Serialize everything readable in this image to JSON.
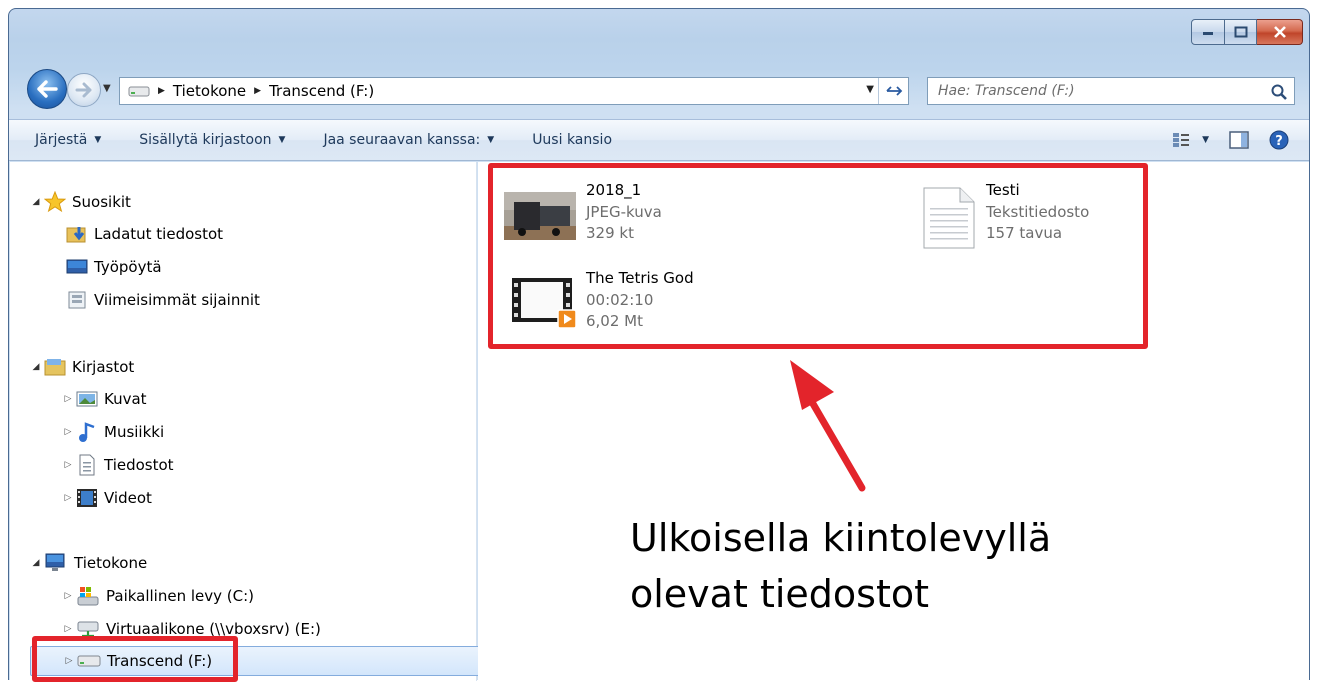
{
  "window": {
    "caption_buttons": [
      "minimize",
      "maximize",
      "close"
    ]
  },
  "address": {
    "crumbs": [
      "Tietokone",
      "Transcend (F:)"
    ],
    "search_placeholder": "Hae: Transcend (F:)"
  },
  "toolbar": {
    "organize": "Järjestä",
    "include_library": "Sisällytä kirjastoon",
    "share_with": "Jaa seuraavan kanssa:",
    "new_folder": "Uusi kansio"
  },
  "nav": {
    "favorites": {
      "label": "Suosikit",
      "items": [
        "Ladatut tiedostot",
        "Työpöytä",
        "Viimeisimmät sijainnit"
      ]
    },
    "libraries": {
      "label": "Kirjastot",
      "items": [
        "Kuvat",
        "Musiikki",
        "Tiedostot",
        "Videot"
      ]
    },
    "computer": {
      "label": "Tietokone",
      "items": [
        "Paikallinen levy (C:)",
        "Virtuaalikone (\\\\vboxsrv) (E:)",
        "Transcend (F:)"
      ],
      "selected": "Transcend (F:)"
    }
  },
  "files": [
    {
      "name": "2018_1",
      "type": "JPEG-kuva",
      "size": "329 kt"
    },
    {
      "name": "Testi",
      "type": "Tekstitiedosto",
      "size": "157 tavua"
    },
    {
      "name": "The Tetris God",
      "type": "00:02:10",
      "size": "6,02 Mt"
    }
  ],
  "annotation": {
    "line1": "Ulkoisella kiintolevyllä",
    "line2": "olevat tiedostot",
    "color": "#e3242b"
  }
}
